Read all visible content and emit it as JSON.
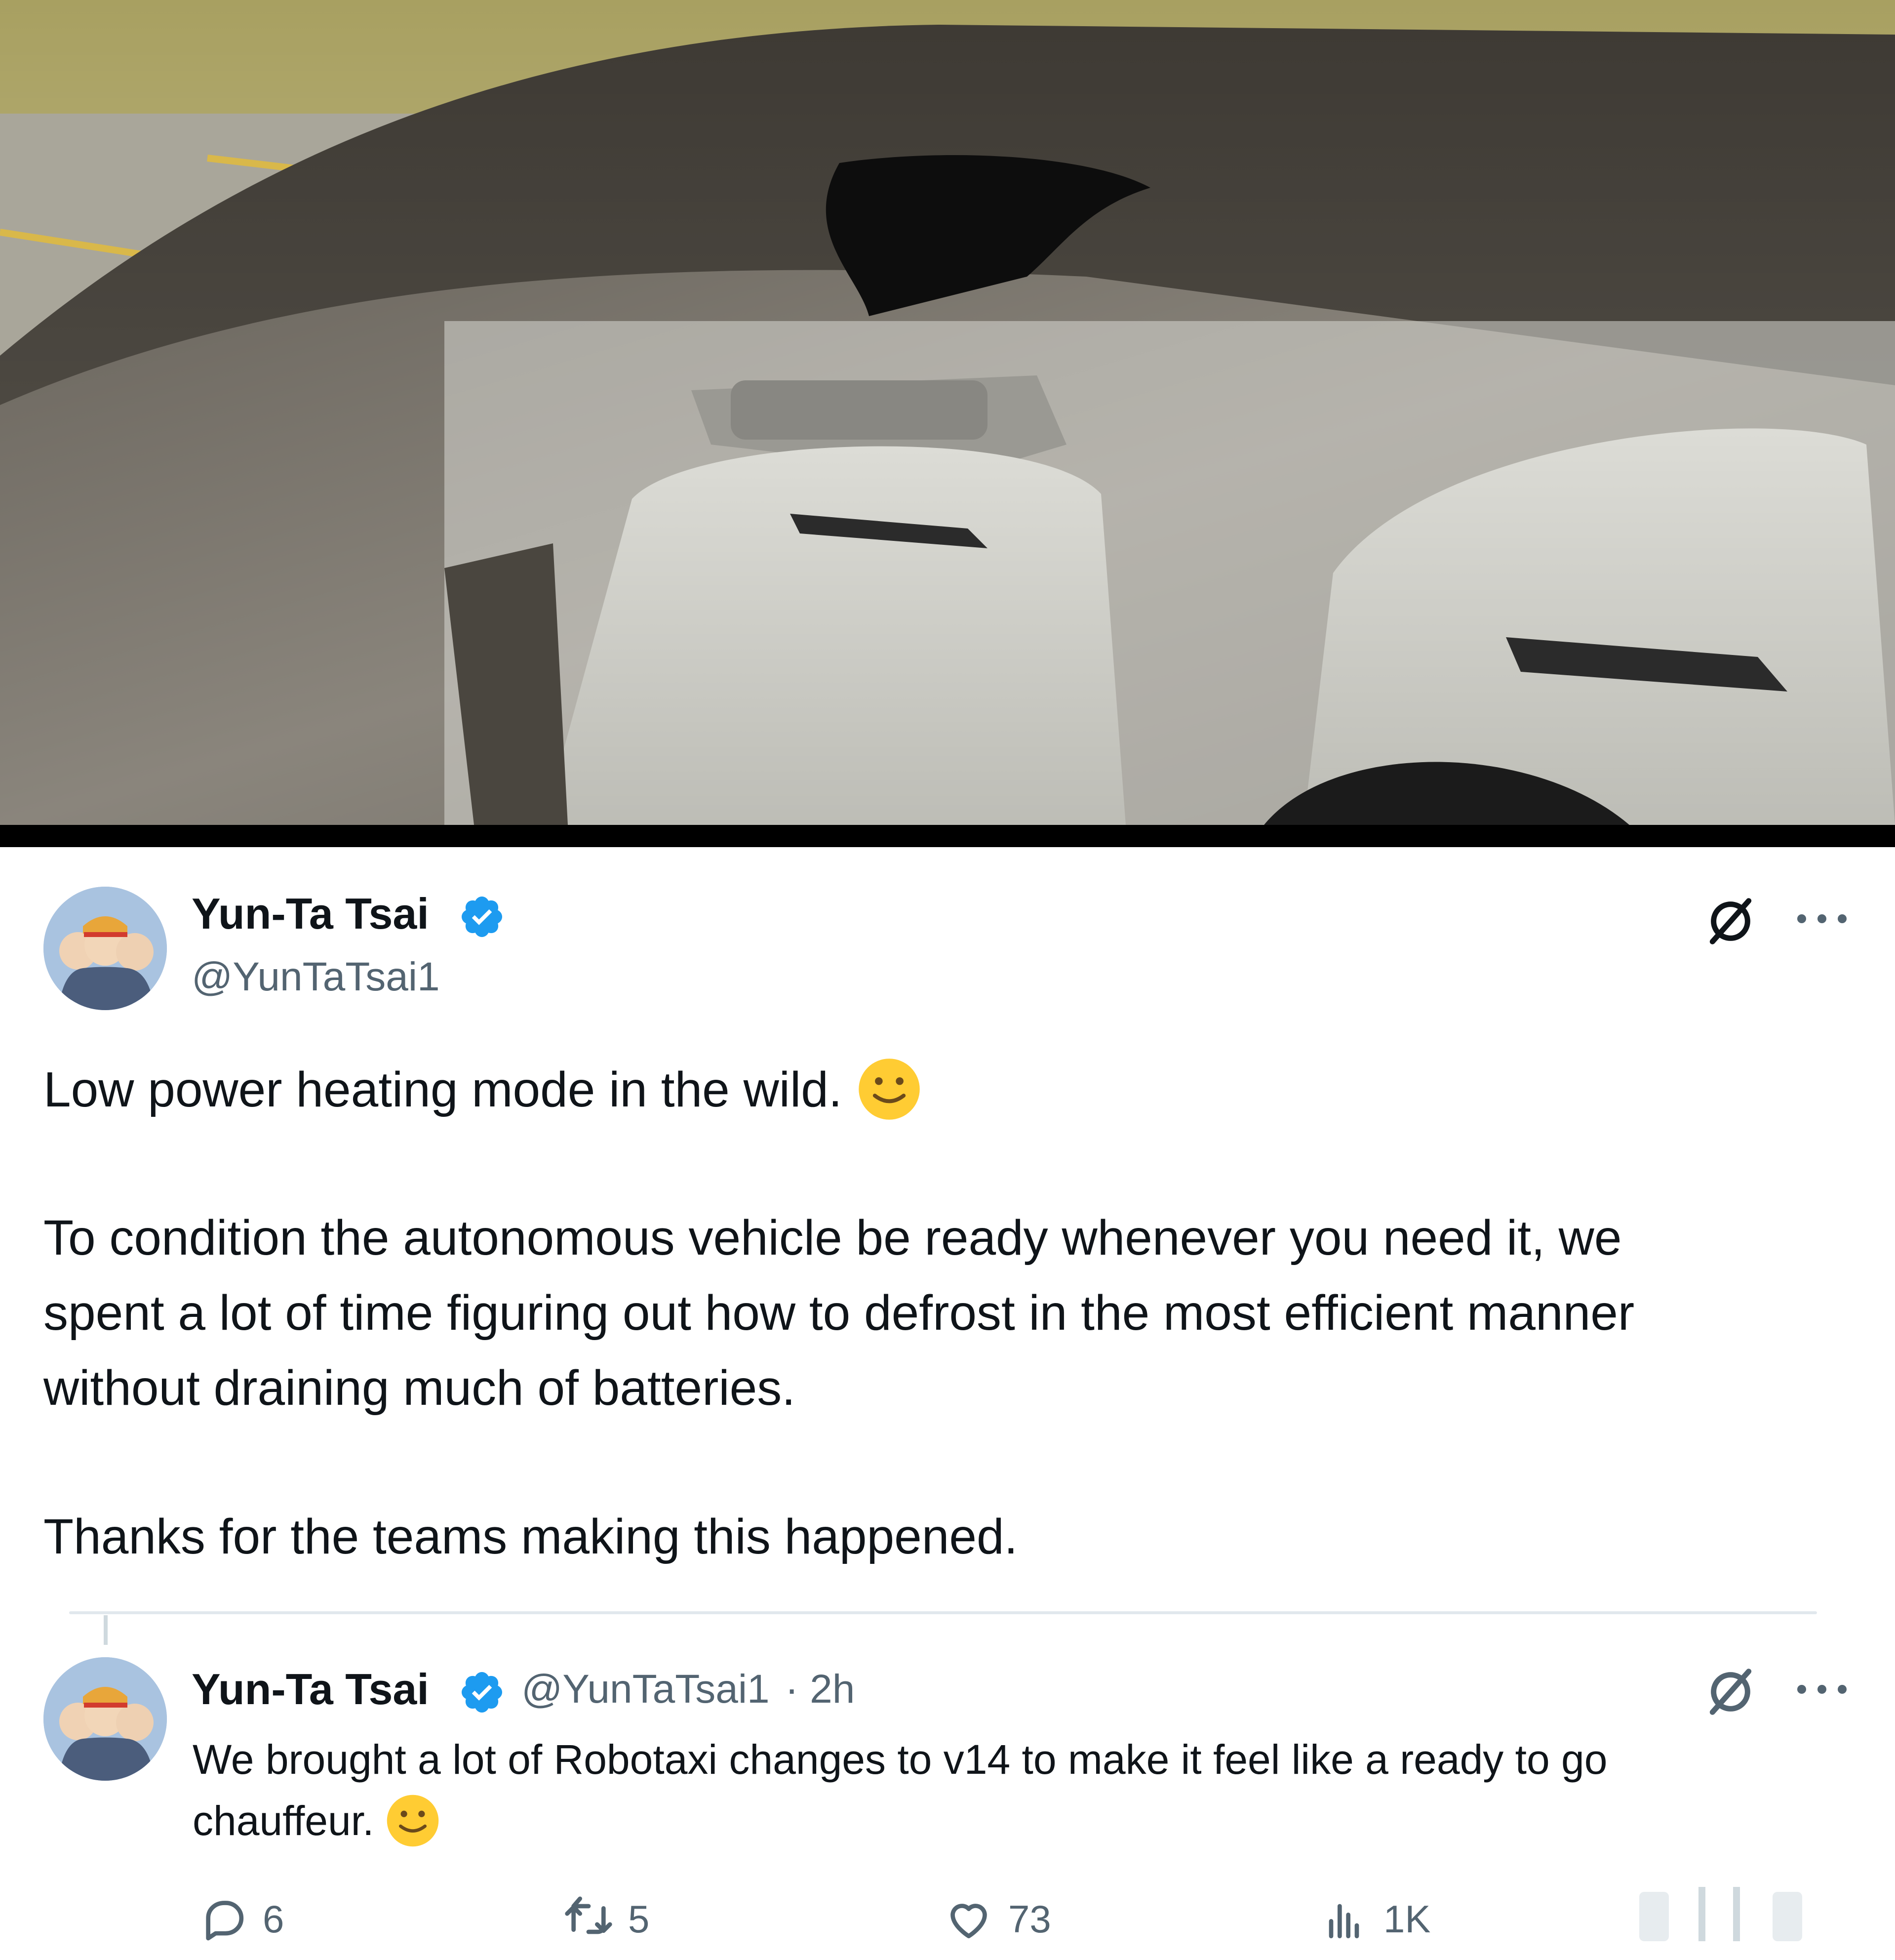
{
  "tweet": {
    "author_name": "Yun-Ta Tsai",
    "author_handle": "@YunTaTsai1",
    "verified": true,
    "paragraphs": [
      "Low power heating mode in the wild.",
      "To condition the autonomous vehicle be ready whenever you need it, we",
      "spent a lot of time figuring out how to defrost in the most efficient manner",
      "without draining much of batteries.",
      "Thanks for the teams making this happened."
    ],
    "emoji": "slightly-smiling-face"
  },
  "reply": {
    "author_name": "Yun-Ta Tsai",
    "author_handle": "@YunTaTsai1",
    "time": "· 2h",
    "lines": [
      "We brought a lot of Robotaxi changes to v14 to make it feel like a ready to go",
      "chauffeur."
    ],
    "actions": {
      "replies": "6",
      "reposts": "5",
      "likes": "73",
      "views": "1K"
    }
  },
  "icons": {
    "verified": "verified-badge-icon",
    "grok": "grok-icon",
    "more": "more-options-icon",
    "reply": "reply-icon",
    "repost": "repost-icon",
    "like": "heart-icon",
    "views": "views-icon"
  },
  "colors": {
    "verified_blue": "#1d9bf0",
    "muted_text": "#536471",
    "text": "#0f1419"
  }
}
